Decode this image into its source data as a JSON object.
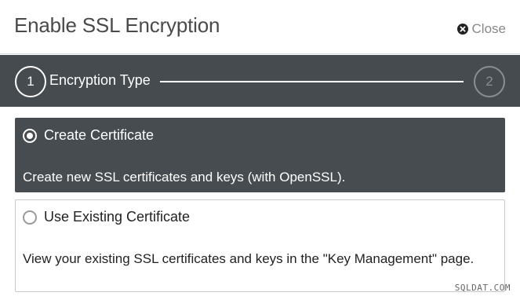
{
  "dialog": {
    "title": "Enable SSL Encryption",
    "close_label": "Close",
    "close_icon": "x-circle-icon"
  },
  "stepper": {
    "current_step": 1,
    "steps": [
      {
        "number": "1",
        "label": "Encryption Type"
      },
      {
        "number": "2",
        "label": ""
      }
    ],
    "colors": {
      "bar_background": "#464b4f",
      "active": "#ffffff",
      "inactive": "#8a8e91"
    }
  },
  "options": [
    {
      "title": "Create Certificate",
      "description": "Create new SSL certificates and keys (with OpenSSL).",
      "selected": true
    },
    {
      "title": "Use Existing Certificate",
      "description": "View your existing SSL certificates and keys in the \"Key Management\" page.",
      "selected": false
    }
  ],
  "watermark": "SQLDAT.COM"
}
